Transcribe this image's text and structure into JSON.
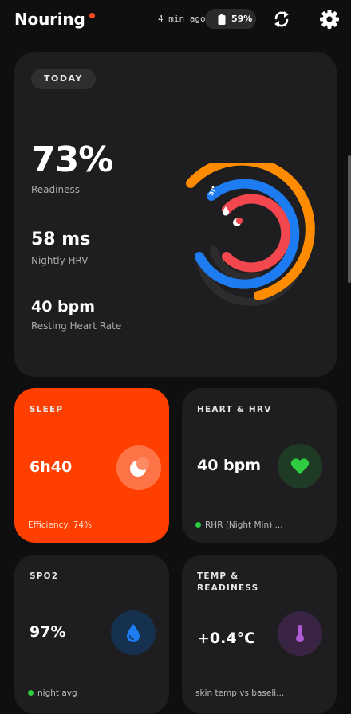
{
  "header": {
    "app_name": "Nouring",
    "sync_time": "4 min ago",
    "battery": "59%"
  },
  "today": {
    "badge": "TODAY",
    "readiness": {
      "value": "73%",
      "label": "Readiness"
    },
    "hrv": {
      "value": "58 ms",
      "label": "Nightly HRV"
    },
    "rhr": {
      "value": "40 bpm",
      "label": "Resting Heart Rate"
    },
    "rings": [
      {
        "name": "activity",
        "color": "#ff8c00",
        "icon": "runner-icon"
      },
      {
        "name": "hydration",
        "color": "#1e7cf2",
        "icon": "water-drop-icon"
      },
      {
        "name": "sleep",
        "color": "#f2474f",
        "icon": "moon-icon"
      }
    ]
  },
  "tiles": {
    "sleep": {
      "title": "SLEEP",
      "value": "6h40",
      "footer": "Efficiency: 74%",
      "color": "#ff3f00"
    },
    "heart": {
      "title": "HEART & HRV",
      "value": "40 bpm",
      "footer": "RHR (Night Min) ...",
      "accent": "#2ecc40"
    },
    "spo2": {
      "title": "SPO2",
      "value": "97%",
      "footer": "night avg",
      "accent": "#1e7cf2"
    },
    "temp": {
      "title": "TEMP & READINESS",
      "value": "+0.4°C",
      "footer": "skin temp vs baseli...",
      "accent": "#b05ad6"
    }
  }
}
